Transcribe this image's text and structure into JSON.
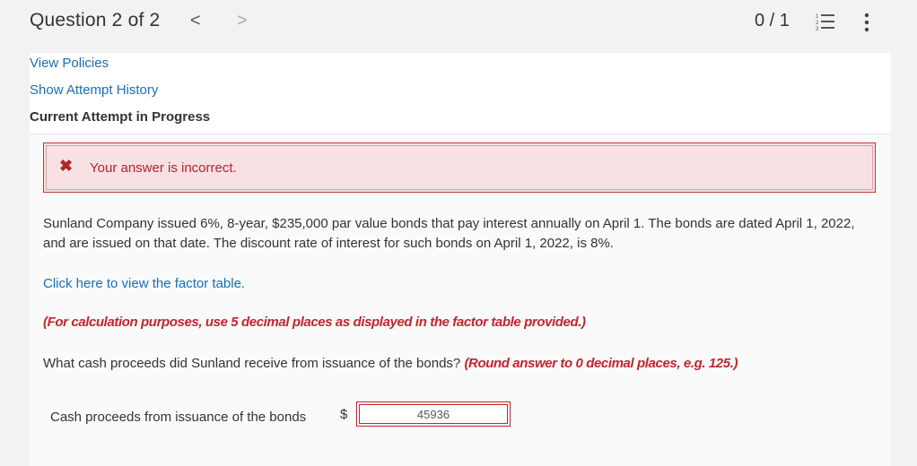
{
  "header": {
    "question_label": "Question 2 of 2",
    "prev_glyph": "<",
    "next_glyph": ">",
    "score": "0 / 1"
  },
  "links": {
    "view_policies": "View Policies",
    "show_attempt_history": "Show Attempt History"
  },
  "attempt_status": "Current Attempt in Progress",
  "feedback": {
    "icon": "x-mark-icon",
    "message": "Your answer is incorrect.",
    "color": "#b0262e"
  },
  "problem": {
    "text": "Sunland Company issued 6%, 8-year, $235,000 par value bonds that pay interest annually on April 1. The bonds are dated April 1, 2022, and are issued on that date. The discount rate of interest for such bonds on April 1, 2022, is 8%.",
    "factor_table_link": "Click here to view the factor table.",
    "calc_note": "(For calculation purposes, use 5 decimal places as displayed in the factor table provided.)",
    "question": "What cash proceeds did Sunland receive from issuance of the bonds?",
    "rounding_note": "(Round answer to 0 decimal places, e.g. 125.)"
  },
  "answer": {
    "label": "Cash proceeds from issuance of the bonds",
    "currency": "$",
    "value": "45936"
  },
  "colors": {
    "link": "#1a6fb3",
    "error": "#c0262e",
    "error_bg": "#f7e1e3"
  }
}
